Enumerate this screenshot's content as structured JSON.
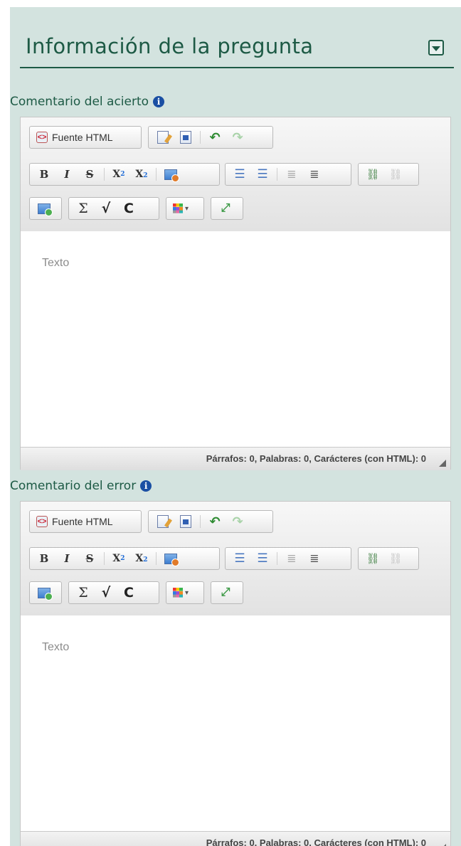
{
  "panel": {
    "title": "Información de la pregunta"
  },
  "fields": [
    {
      "label": "Comentario del acierto",
      "toolbar": {
        "source_label": "Fuente HTML"
      },
      "placeholder": "Texto",
      "status": "Párrafos: 0, Palabras: 0, Carácteres (con HTML): 0"
    },
    {
      "label": "Comentario del error",
      "toolbar": {
        "source_label": "Fuente HTML"
      },
      "placeholder": "Texto",
      "status": "Párrafos: 0, Palabras: 0, Carácteres (con HTML): 0"
    }
  ],
  "toolbar_glyphs": {
    "bold": "B",
    "italic": "I",
    "strike": "S",
    "sub": "X",
    "sub_mark": "2",
    "sup": "X",
    "sup_mark": "2",
    "info": "i",
    "sigma": "Σ",
    "sqrt": "√",
    "chem": "C"
  },
  "colors": {
    "panel_bg": "#d3e3df",
    "accent": "#1d5a45",
    "info_icon": "#1a4fa3"
  },
  "icons": {
    "collapse": "chevron-down-icon",
    "info": "info-icon",
    "source": "html-source-icon"
  }
}
